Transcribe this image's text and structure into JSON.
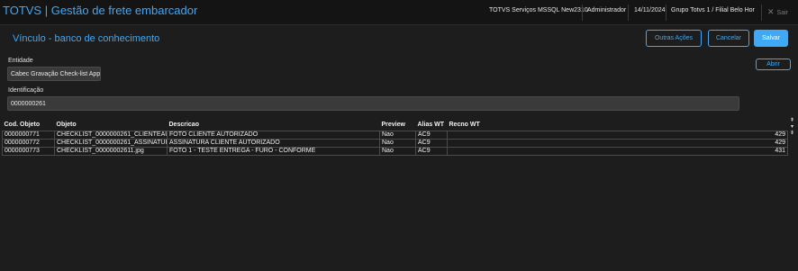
{
  "header": {
    "app_title": "TOTVS | Gestão de frete embarcador",
    "environment": "TOTVS Serviços MSSQL New2310",
    "user": "Administrador",
    "date": "14/11/2024",
    "branch": "Grupo Totvs 1 / Filial Belo Hor",
    "exit_label": "Sair",
    "exit_icon": "close-icon"
  },
  "page": {
    "title": "Vínculo - banco de conhecimento"
  },
  "toolbar": {
    "outras_acoes_label": "Outras Ações",
    "cancelar_label": "Cancelar",
    "salvar_label": "Salvar",
    "abrir_label": "Abrir"
  },
  "form": {
    "entidade_label": "Entidade",
    "entidade_value": "Cabec Gravação Check-list App",
    "identificacao_label": "Identificação",
    "identificacao_value": "0000000261"
  },
  "grid": {
    "columns": [
      "Cod. Objeto",
      "Objeto",
      "Descricao",
      "Preview",
      "Alias WT",
      "Recno WT"
    ],
    "rows": [
      [
        "0000000771",
        "CHECKLIST_0000000261_CLIENTEAU",
        "FOTO CLIENTE AUTORIZADO",
        "Nao",
        "AC9",
        "429"
      ],
      [
        "0000000772",
        "CHECKLIST_0000000261_ASSINATUR",
        "ASSINATURA CLIENTE AUTORIZADO",
        "Nao",
        "AC9",
        "429"
      ],
      [
        "0000000773",
        "CHECKLIST_00000002611.jpg",
        "FOTO 1 - TESTE ENTREGA - FURO - CONFORME",
        "Nao",
        "AC9",
        "431"
      ]
    ]
  },
  "colors": {
    "accent": "#3fa9f5",
    "background": "#1d1d1d",
    "topbar": "#141414"
  }
}
